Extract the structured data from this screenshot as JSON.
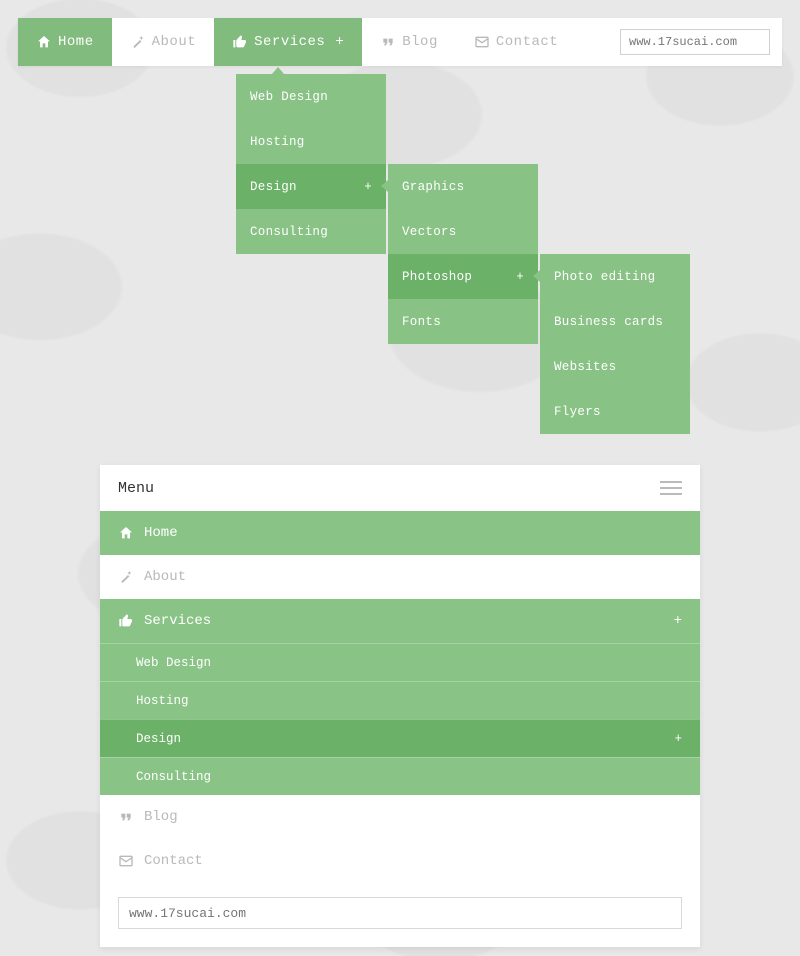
{
  "topnav": {
    "items": [
      {
        "label": "Home",
        "icon": "home"
      },
      {
        "label": "About",
        "icon": "magic"
      },
      {
        "label": "Services",
        "icon": "thumbs-up",
        "plus": "+"
      },
      {
        "label": "Blog",
        "icon": "quote"
      },
      {
        "label": "Contact",
        "icon": "envelope"
      }
    ],
    "search_placeholder": "www.17sucai.com"
  },
  "flyout1": {
    "items": [
      "Web Design",
      "Hosting",
      "Design",
      "Consulting"
    ],
    "plus": "+"
  },
  "flyout2": {
    "items": [
      "Graphics",
      "Vectors",
      "Photoshop",
      "Fonts"
    ],
    "plus": "+"
  },
  "flyout3": {
    "items": [
      "Photo editing",
      "Business cards",
      "Websites",
      "Flyers"
    ]
  },
  "mobile": {
    "header": "Menu",
    "items": [
      {
        "label": "Home",
        "icon": "home",
        "style": "green"
      },
      {
        "label": "About",
        "icon": "magic",
        "style": "white"
      },
      {
        "label": "Services",
        "icon": "thumbs-up",
        "style": "green",
        "plus": "+"
      }
    ],
    "services_sub": [
      "Web Design",
      "Hosting",
      "Design",
      "Consulting"
    ],
    "services_sub_plus": "+",
    "tail": [
      {
        "label": "Blog",
        "icon": "quote",
        "style": "white"
      },
      {
        "label": "Contact",
        "icon": "envelope",
        "style": "white"
      }
    ],
    "search_placeholder": "www.17sucai.com"
  }
}
